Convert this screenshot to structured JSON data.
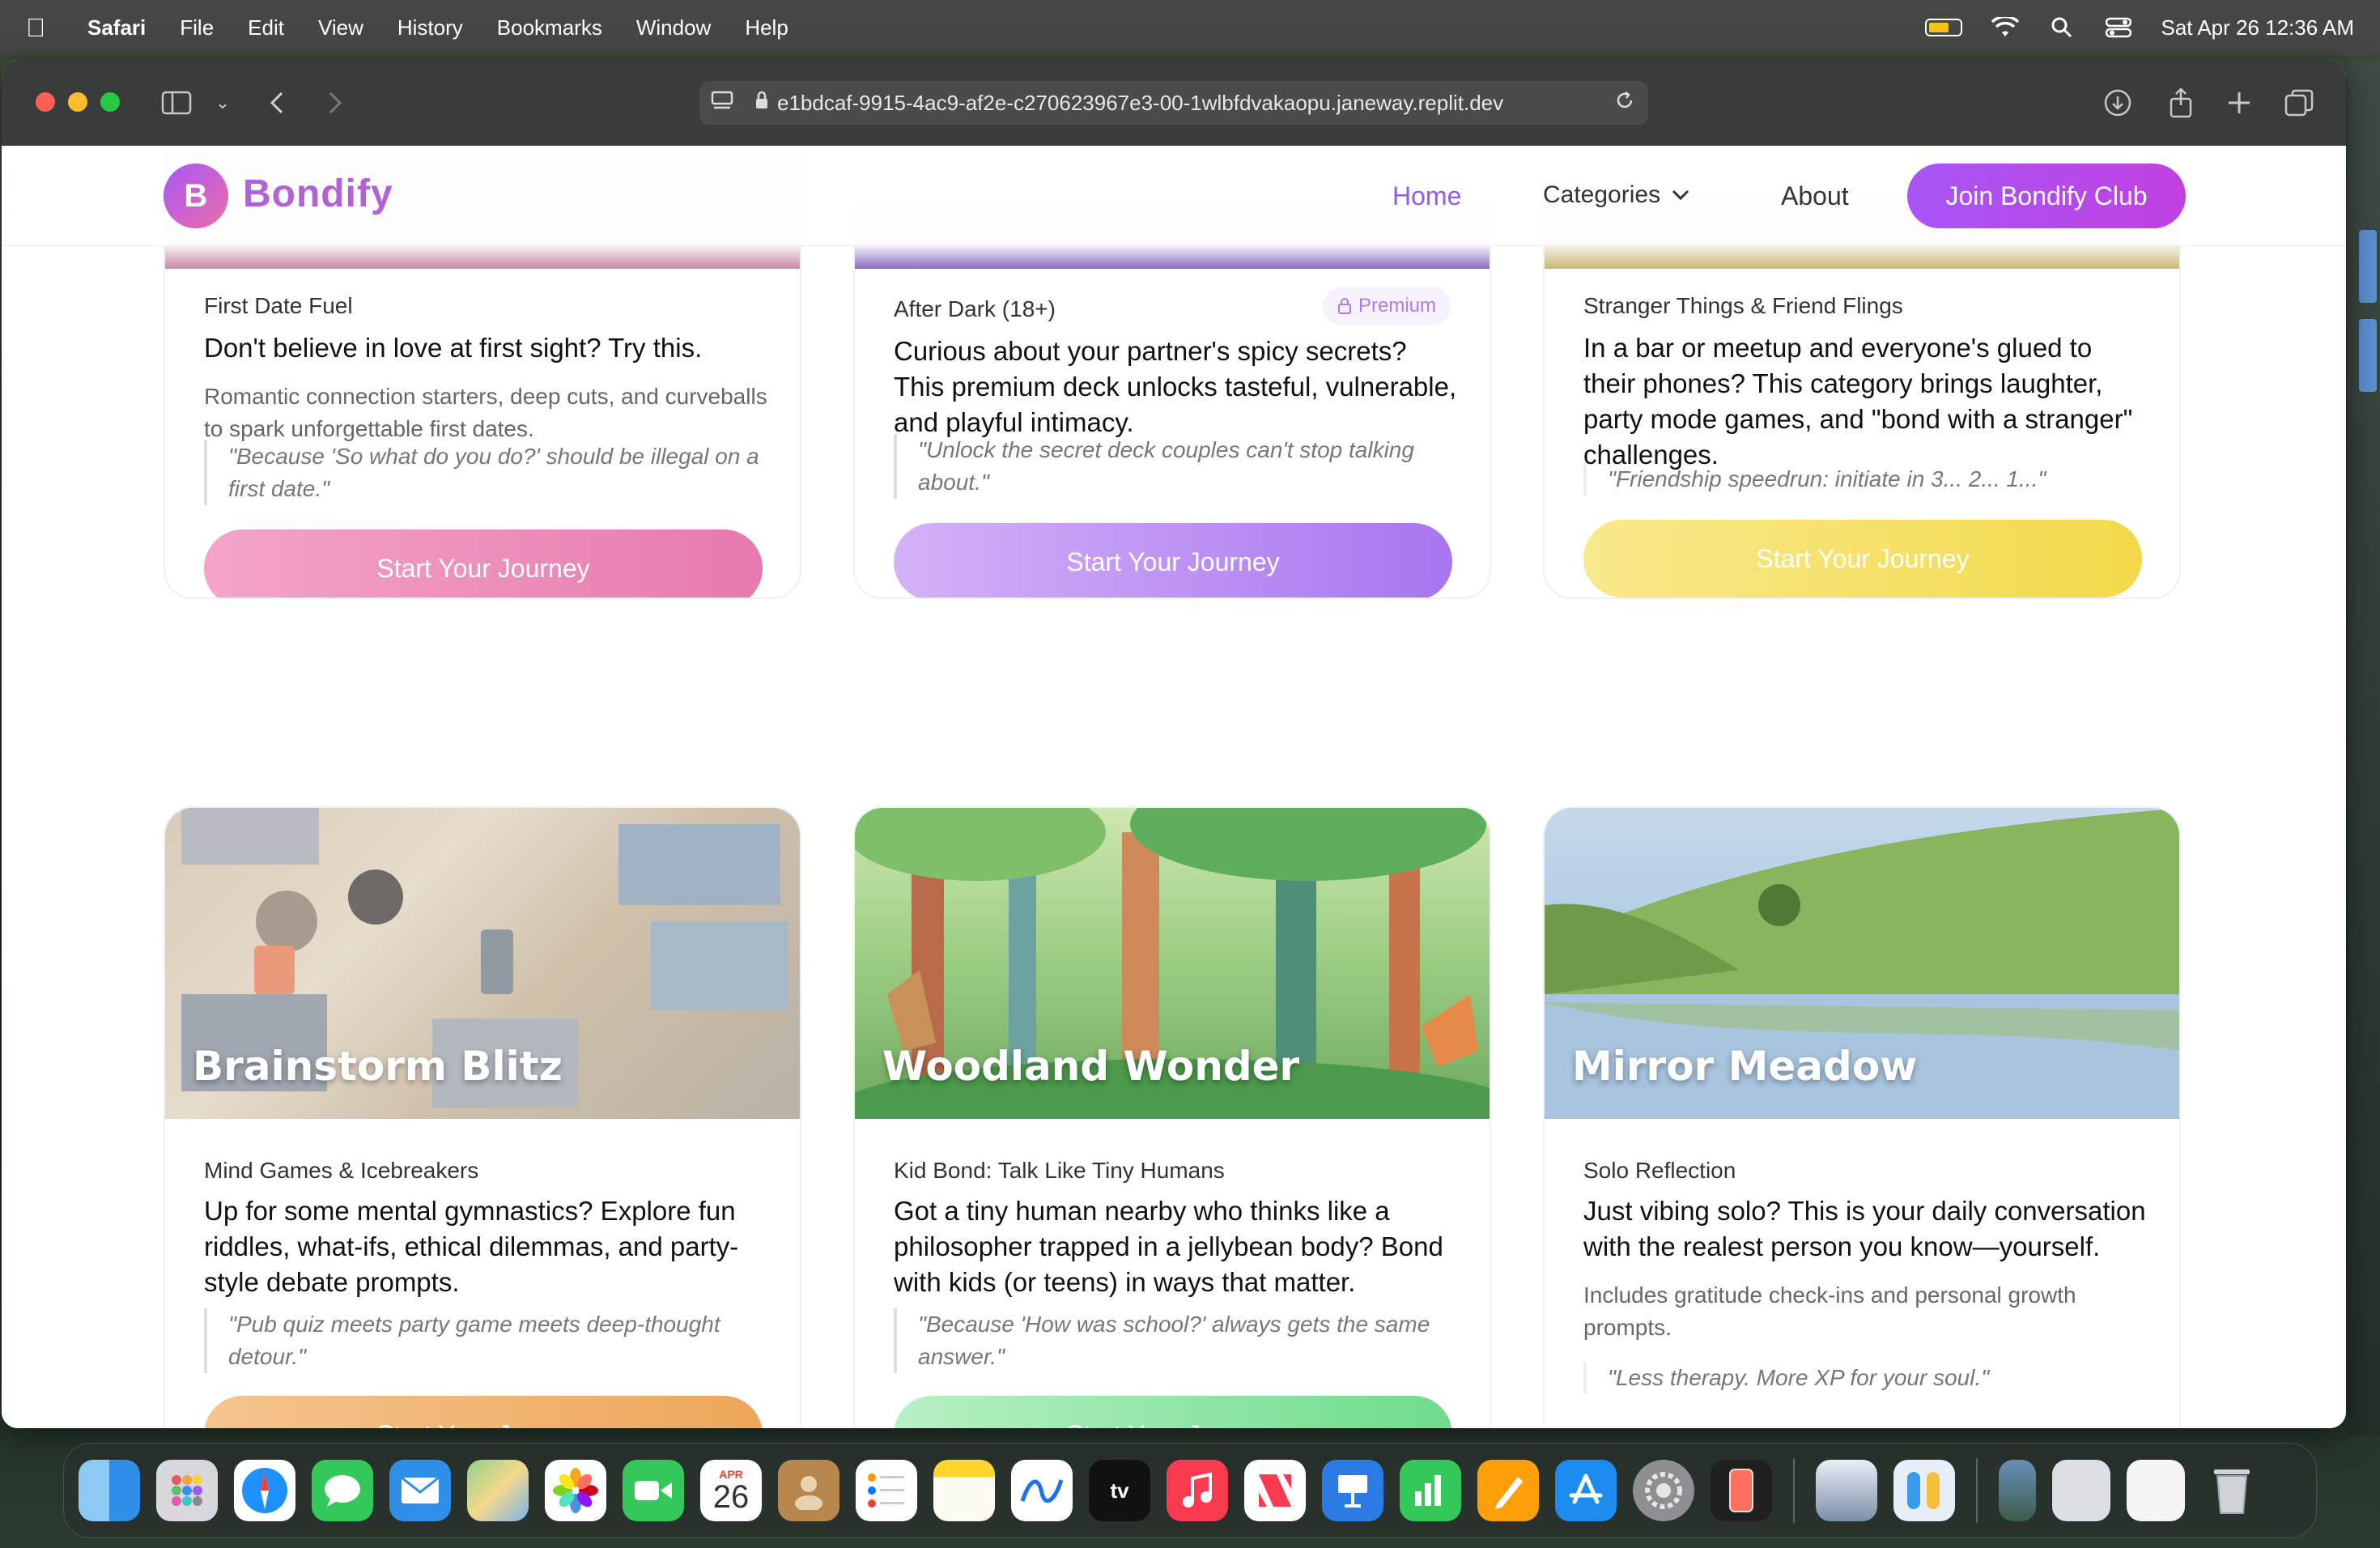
{
  "menubar": {
    "app_name": "Safari",
    "items": [
      "File",
      "Edit",
      "View",
      "History",
      "Bookmarks",
      "Window",
      "Help"
    ],
    "datetime": "Sat Apr 26  12:36 AM"
  },
  "browser": {
    "url": "e1bdcaf-9915-4ac9-af2e-c270623967e3-00-1wlbfdvakaopu.janeway.replit.dev"
  },
  "site": {
    "logo_letter": "B",
    "logo_name": "Bondify",
    "nav": {
      "home": "Home",
      "categories": "Categories",
      "about": "About",
      "join": "Join Bondify Club"
    }
  },
  "cards": [
    {
      "category": "First Date Fuel",
      "headline": "Don't believe in love at first sight? Try this.",
      "sub": "Romantic connection starters, deep cuts, and curveballs to spark unforgettable first dates.",
      "quote": "\"Because 'So what do you do?' should be illegal on a first date.\"",
      "button": "Start Your Journey",
      "color": "#ec7fb0"
    },
    {
      "category": "After Dark (18+)",
      "badge": "Premium",
      "headline": "Curious about your partner's spicy secrets? This premium deck unlocks tasteful, vulnerable, and playful intimacy.",
      "quote": "\"Unlock the secret deck couples can't stop talking about.\"",
      "button": "Start Your Journey",
      "color": "#a875f0"
    },
    {
      "category": "Stranger Things & Friend Flings",
      "headline": "In a bar or meetup and everyone's glued to their phones? This category brings laughter, party mode games, and \"bond with a stranger\" challenges.",
      "quote": "\"Friendship speedrun: initiate in 3... 2... 1...\"",
      "button": "Start Your Journey",
      "color": "#f5d94a"
    },
    {
      "image_title": "Brainstorm Blitz",
      "category": "Mind Games & Icebreakers",
      "headline": "Up for some mental gymnastics? Explore fun riddles, what-ifs, ethical dilemmas, and party-style debate prompts.",
      "quote": "\"Pub quiz meets party game meets deep-thought detour.\"",
      "button": "Start Your Journey",
      "color": "#f0a050"
    },
    {
      "image_title": "Woodland Wonder",
      "category": "Kid Bond: Talk Like Tiny Humans",
      "headline": "Got a tiny human nearby who thinks like a philosopher trapped in a jellybean body? Bond with kids (or teens) in ways that matter.",
      "quote": "\"Because 'How was school?' always gets the same answer.\"",
      "button": "Start Your Journey",
      "color": "#6fdc8c"
    },
    {
      "image_title": "Mirror Meadow",
      "category": "Solo Reflection",
      "headline": "Just vibing solo? This is your daily conversation with the realest person you know—yourself.",
      "sub": "Includes gratitude check-ins and personal growth prompts.",
      "quote": "\"Less therapy. More XP for your soul.\""
    }
  ],
  "dock": {
    "calendar_month": "APR",
    "calendar_day": "26",
    "tv_label": "tv"
  }
}
